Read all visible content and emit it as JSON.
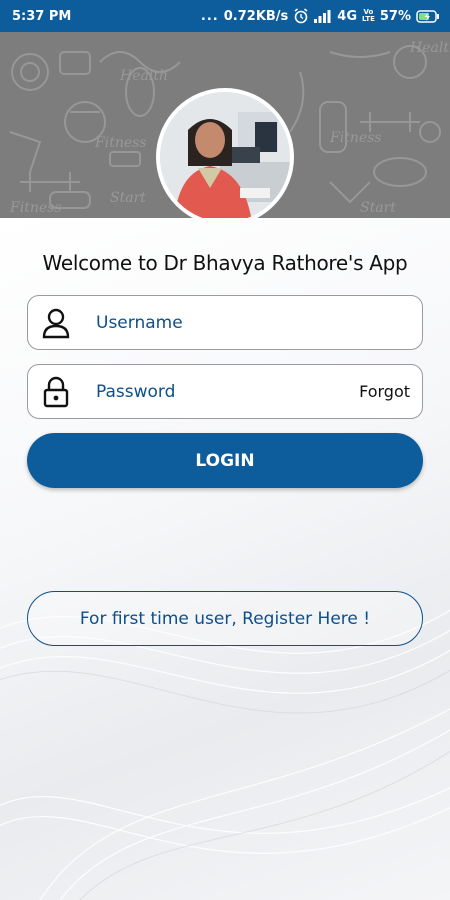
{
  "status_bar": {
    "time": "5:37 PM",
    "dots": "...",
    "network_speed": "0.72KB/s",
    "network_type": "4G",
    "volte_top": "Vo",
    "volte_bottom": "LTE",
    "battery": "57%",
    "icons": [
      "alarm-icon",
      "signal-icon",
      "volte-icon",
      "battery-charging-icon"
    ]
  },
  "header": {
    "background_color": "#7d7d7d",
    "profile_photo": "doctor-profile-photo"
  },
  "welcome_text": "Welcome to Dr Bhavya Rathore's App",
  "username_field": {
    "placeholder": "Username",
    "icon": "user-icon"
  },
  "password_field": {
    "placeholder": "Password",
    "icon": "lock-icon",
    "forgot_label": "Forgot"
  },
  "login_button": {
    "label": "LOGIN"
  },
  "register_button": {
    "label": "For first time user, Register Here !"
  },
  "colors": {
    "primary": "#0d5d9c",
    "text_blue": "#0d4f8c",
    "status_bar": "#0d5d9c"
  }
}
